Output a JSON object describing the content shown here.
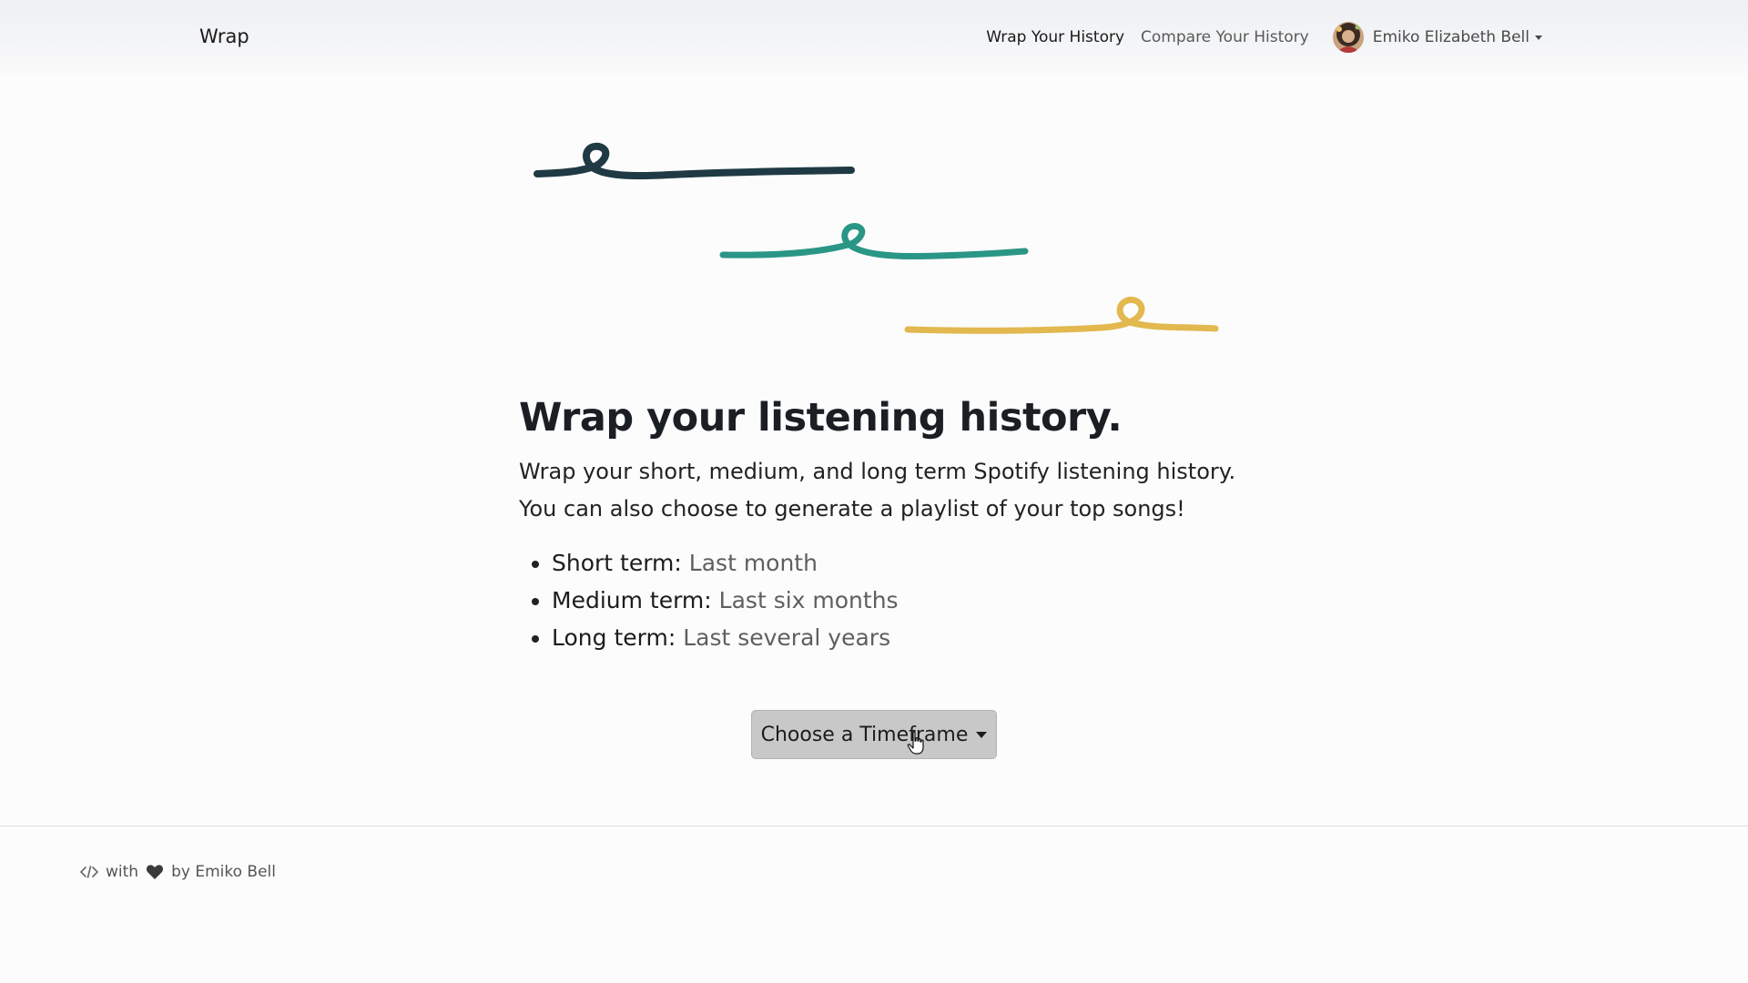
{
  "nav": {
    "brand": "Wrap",
    "links": [
      {
        "label": "Wrap Your History",
        "active": true
      },
      {
        "label": "Compare Your History",
        "active": false
      }
    ],
    "user_name": "Emiko Elizabeth Bell"
  },
  "hero": {
    "squiggle_colors": [
      "#1f3a44",
      "#2a9686",
      "#e2b84f"
    ]
  },
  "main": {
    "headline": "Wrap your listening history.",
    "intro_line1": "Wrap your short, medium, and long term Spotify listening history.",
    "intro_line2": "You can also choose to generate a playlist of your top songs!",
    "terms": [
      {
        "label": "Short term:",
        "value": "Last month"
      },
      {
        "label": "Medium term:",
        "value": "Last six months"
      },
      {
        "label": "Long term:",
        "value": "Last several years"
      }
    ],
    "timeframe_button": "Choose a Timeframe"
  },
  "footer": {
    "with_text": "with",
    "by_text": "by Emiko Bell",
    "code_icon": "code-icon",
    "heart_icon": "heart-icon"
  }
}
